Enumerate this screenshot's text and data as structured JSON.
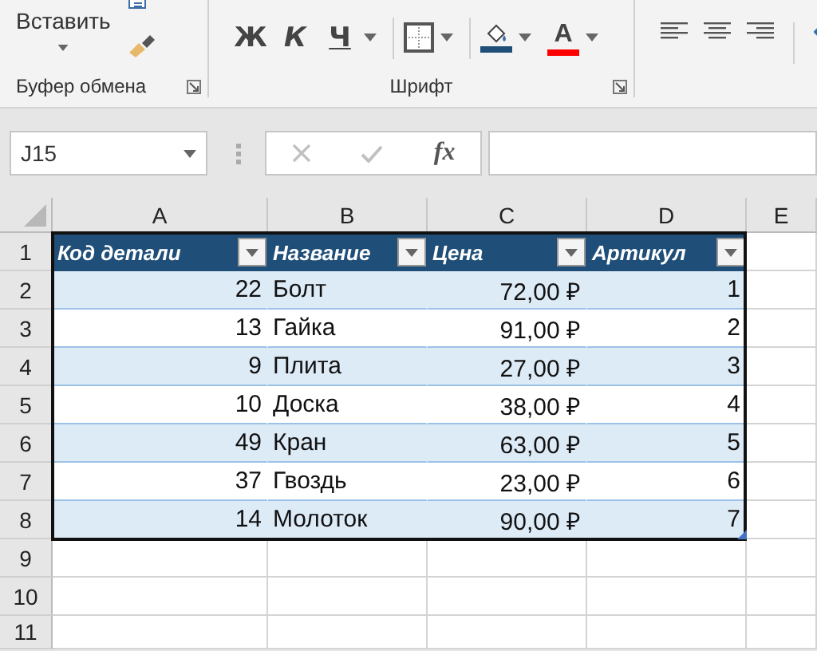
{
  "ribbon": {
    "clipboard": {
      "paste_label": "Вставить",
      "group_label": "Буфер обмена"
    },
    "font": {
      "bold": "Ж",
      "italic": "К",
      "underline": "Ч",
      "font_color": "A",
      "group_label": "Шрифт"
    }
  },
  "formula_bar": {
    "name_box": "J15",
    "function_label": "fx"
  },
  "columns": [
    "A",
    "B",
    "C",
    "D",
    "E"
  ],
  "row_numbers": [
    "1",
    "2",
    "3",
    "4",
    "5",
    "6",
    "7",
    "8",
    "9",
    "10",
    "11"
  ],
  "table": {
    "headers": [
      "Код детали",
      "Название",
      "Цена",
      "Артикул"
    ],
    "rows": [
      [
        "22",
        "Болт",
        "72,00 ₽",
        "1"
      ],
      [
        "13",
        "Гайка",
        "91,00 ₽",
        "2"
      ],
      [
        "9",
        "Плита",
        "27,00 ₽",
        "3"
      ],
      [
        "10",
        "Доска",
        "38,00 ₽",
        "4"
      ],
      [
        "49",
        "Кран",
        "63,00 ₽",
        "5"
      ],
      [
        "37",
        "Гвоздь",
        "23,00 ₽",
        "6"
      ],
      [
        "14",
        "Молоток",
        "90,00 ₽",
        "7"
      ]
    ]
  }
}
